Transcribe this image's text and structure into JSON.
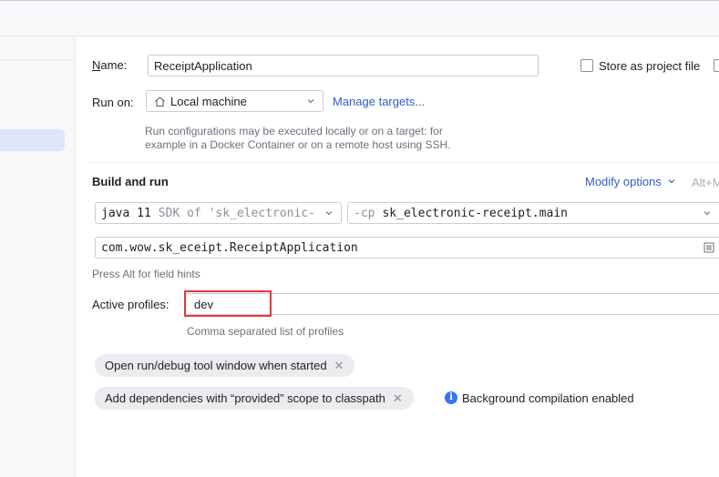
{
  "name_label": "Name:",
  "name_value": "ReceiptApplication",
  "store_as_project_file": "Store as project file",
  "run_on_label": "Run on:",
  "run_on_value": "Local machine",
  "manage_targets": "Manage targets...",
  "run_on_hint_line1": "Run configurations may be executed locally or on a target: for",
  "run_on_hint_line2": "example in a Docker Container or on a remote host using SSH.",
  "build_and_run": "Build and run",
  "modify_options": "Modify options",
  "modify_shortcut": "Alt+M",
  "jdk": {
    "version": "java 11",
    "sdk_text": "SDK of 'sk_electronic-"
  },
  "classpath": {
    "flag": "-cp",
    "module": "sk_electronic-receipt.main"
  },
  "main_class": "com.wow.sk_eceipt.ReceiptApplication",
  "field_hint": "Press Alt for field hints",
  "active_profiles_label": "Active profiles:",
  "active_profiles_value": "dev",
  "active_profiles_hint": "Comma separated list of profiles",
  "chip_open_window": "Open run/debug tool window when started",
  "chip_add_deps": "Add dependencies with “provided” scope to classpath",
  "background_compilation": "Background compilation enabled",
  "colors": {
    "highlight": "#e53935",
    "link": "#2f5ec4",
    "info": "#3574f0"
  }
}
